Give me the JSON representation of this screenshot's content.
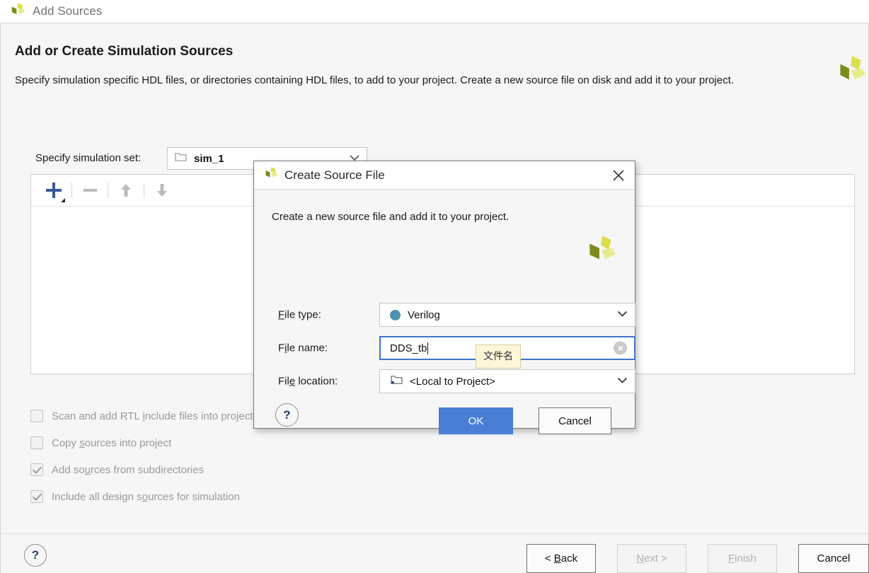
{
  "window": {
    "title": "Add Sources",
    "icon": "xilinx-logo-icon"
  },
  "wizard": {
    "page_title": "Add or Create Simulation Sources",
    "page_description": "Specify simulation specific HDL files, or directories containing HDL files, to add to your project. Create a new source file on disk and add it to your project.",
    "simset": {
      "label": "Specify simulation set:",
      "value": "sim_1",
      "folder_icon": "folder-icon",
      "caret_icon": "chevron-down-icon"
    },
    "toolbar": {
      "add": "+",
      "remove": "−",
      "move_up": "↑",
      "move_down": "↓"
    },
    "options": [
      {
        "label_pre": "Scan and add RTL ",
        "label_key": "i",
        "label_post": "nclude files into project",
        "checked": false
      },
      {
        "label_pre": "Copy ",
        "label_key": "s",
        "label_post": "ources into project",
        "checked": false
      },
      {
        "label_pre": "Add so",
        "label_key": "u",
        "label_post": "rces from subdirectories",
        "checked": true
      },
      {
        "label_pre": "Include all design s",
        "label_key": "o",
        "label_post": "urces for simulation",
        "checked": true
      }
    ],
    "footer": {
      "help": "?",
      "back_pre": "< ",
      "back_key": "B",
      "back_post": "ack",
      "back_disabled": false,
      "next_key": "N",
      "next_post": "ext >",
      "next_disabled": true,
      "finish_key": "F",
      "finish_post": "inish",
      "finish_disabled": true,
      "cancel": "Cancel",
      "cancel_disabled": false
    }
  },
  "modal": {
    "title": "Create Source File",
    "title_icon": "xilinx-logo-icon",
    "close_icon": "close-icon",
    "description": "Create a new source file and add it to your project.",
    "fields": {
      "file_type": {
        "label_key": "F",
        "label_post": "ile type:",
        "value": "Verilog",
        "bullet_color": "#4d93ae",
        "caret_icon": "chevron-down-icon"
      },
      "file_name": {
        "label_pre": "F",
        "label_key": "i",
        "label_post": "le name:",
        "value": "DDS_tb",
        "placeholder": "",
        "clear_icon": "clear-circle-icon",
        "focused": true
      },
      "file_location": {
        "label_pre": "Fil",
        "label_key": "e",
        "label_post": " location:",
        "value": "<Local to Project>",
        "folder_icon": "folder-icon",
        "caret_icon": "chevron-down-icon"
      }
    },
    "tooltip": "文件名",
    "help": "?",
    "ok": "OK",
    "cancel": "Cancel"
  },
  "colors": {
    "accent_blue": "#4a7ed4",
    "focus_blue": "#3f74c8",
    "plus_blue": "#37589c",
    "teal": "#4d93ae",
    "logo_dark": "#7d8b1c",
    "logo_mid": "#d9e04b",
    "logo_light": "#e6ec8b",
    "tooltip_bg": "#fdf6d8",
    "page_bg": "#f6f6f6"
  }
}
